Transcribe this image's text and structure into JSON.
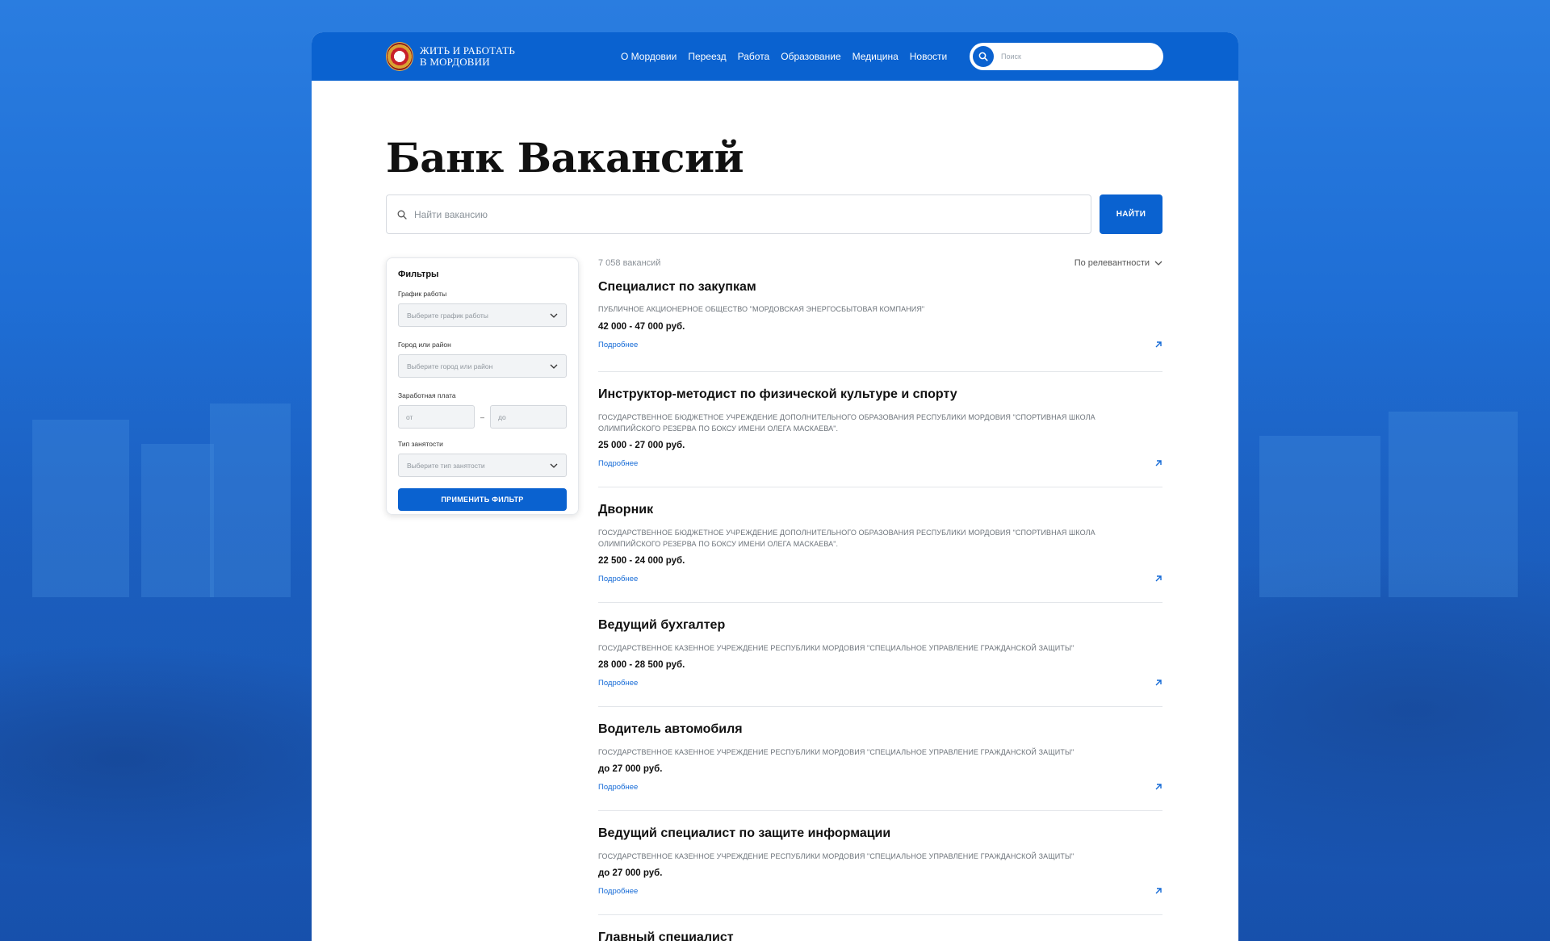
{
  "header": {
    "logo_line1": "ЖИТЬ И РАБОТАТЬ",
    "logo_line2": "В МОРДОВИИ",
    "nav": [
      "О Мордовии",
      "Переезд",
      "Работа",
      "Образование",
      "Медицина",
      "Новости"
    ],
    "search_placeholder": "Поиск"
  },
  "page": {
    "title": "Банк Вакансий",
    "search_placeholder": "Найти вакансию",
    "find_button": "НАЙТИ"
  },
  "filters": {
    "title": "Фильтры",
    "schedule_label": "График работы",
    "schedule_placeholder": "Выберите график работы",
    "city_label": "Город или район",
    "city_placeholder": "Выберите город или район",
    "salary_label": "Заработная плата",
    "salary_from": "от",
    "salary_dash": "–",
    "salary_to": "до",
    "type_label": "Тип занятости",
    "type_placeholder": "Выберите тип занятости",
    "apply_button": "ПРИМЕНИТЬ ФИЛЬТР"
  },
  "list": {
    "count": "7 058 вакансий",
    "sort": "По релевантности",
    "more_label": "Подробнее",
    "vacancies": [
      {
        "title": "Специалист по закупкам",
        "org": "ПУБЛИЧНОЕ АКЦИОНЕРНОЕ ОБЩЕСТВО \"МОРДОВСКАЯ ЭНЕРГОСБЫТОВАЯ КОМПАНИЯ\"",
        "salary": "42 000 - 47 000 руб."
      },
      {
        "title": "Инструктор-методист по физической культуре и спорту",
        "org": "ГОСУДАРСТВЕННОЕ БЮДЖЕТНОЕ УЧРЕЖДЕНИЕ ДОПОЛНИТЕЛЬНОГО ОБРАЗОВАНИЯ РЕСПУБЛИКИ МОРДОВИЯ \"СПОРТИВНАЯ ШКОЛА ОЛИМПИЙСКОГО РЕЗЕРВА ПО БОКСУ ИМЕНИ ОЛЕГА МАСКАЕВА\".",
        "salary": "25 000 - 27 000 руб."
      },
      {
        "title": "Дворник",
        "org": "ГОСУДАРСТВЕННОЕ БЮДЖЕТНОЕ УЧРЕЖДЕНИЕ ДОПОЛНИТЕЛЬНОГО ОБРАЗОВАНИЯ РЕСПУБЛИКИ МОРДОВИЯ \"СПОРТИВНАЯ ШКОЛА ОЛИМПИЙСКОГО РЕЗЕРВА ПО БОКСУ ИМЕНИ ОЛЕГА МАСКАЕВА\".",
        "salary": "22 500 - 24 000 руб."
      },
      {
        "title": "Ведущий бухгалтер",
        "org": "ГОСУДАРСТВЕННОЕ КАЗЕННОЕ УЧРЕЖДЕНИЕ РЕСПУБЛИКИ МОРДОВИЯ \"СПЕЦИАЛЬНОЕ УПРАВЛЕНИЕ ГРАЖДАНСКОЙ ЗАЩИТЫ\"",
        "salary": "28 000 - 28 500 руб."
      },
      {
        "title": "Водитель автомобиля",
        "org": "ГОСУДАРСТВЕННОЕ КАЗЕННОЕ УЧРЕЖДЕНИЕ РЕСПУБЛИКИ МОРДОВИЯ \"СПЕЦИАЛЬНОЕ УПРАВЛЕНИЕ ГРАЖДАНСКОЙ ЗАЩИТЫ\"",
        "salary": "до 27 000 руб."
      },
      {
        "title": "Ведущий специалист по защите информации",
        "org": "ГОСУДАРСТВЕННОЕ КАЗЕННОЕ УЧРЕЖДЕНИЕ РЕСПУБЛИКИ МОРДОВИЯ \"СПЕЦИАЛЬНОЕ УПРАВЛЕНИЕ ГРАЖДАНСКОЙ ЗАЩИТЫ\"",
        "salary": "до 27 000 руб."
      },
      {
        "title": "Главный специалист",
        "org": "",
        "salary": ""
      }
    ]
  }
}
